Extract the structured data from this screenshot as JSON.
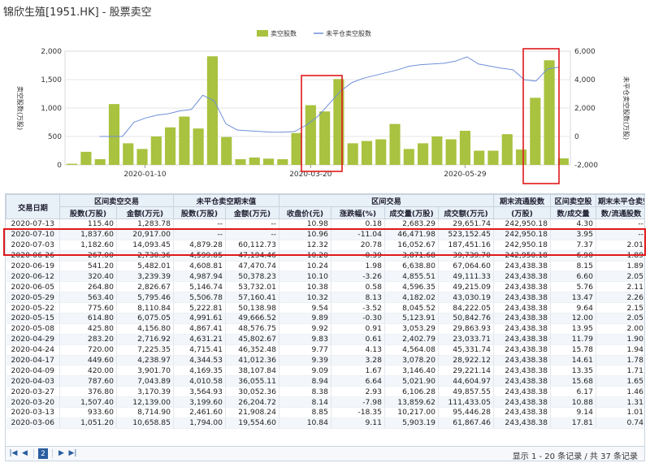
{
  "page": {
    "title": "锦欣生殖[1951.HK] - 股票卖空"
  },
  "colors": {
    "bar": "#a9c23f",
    "line": "#6f8fd8",
    "highlight": "#e0181b",
    "header_bg": "#e8f0f8"
  },
  "chart_data": {
    "type": "bar",
    "title": "",
    "y_left": {
      "ylim": [
        0,
        2000
      ],
      "ticks": [
        "0",
        "500",
        "1,000",
        "1,500",
        "2,000"
      ],
      "label": "卖空股数(万股)"
    },
    "y_right": {
      "ylim": [
        -2000,
        6000
      ],
      "ticks": [
        "-2,000",
        "0",
        "2,000",
        "4,000",
        "6,000"
      ],
      "label": "未平仓卖空股数(万股)"
    },
    "x_ticks": [
      "2020-01-10",
      "2020-03-20",
      "2020-05-29"
    ],
    "legend_position": "top-center",
    "grid": true,
    "series": [
      {
        "name": "卖空股数",
        "kind": "bar",
        "values": [
          20,
          230,
          100,
          1070,
          380,
          280,
          500,
          660,
          850,
          640,
          1910,
          490,
          100,
          130,
          110,
          100,
          560,
          1050,
          940,
          1510,
          380,
          420,
          450,
          720,
          280,
          380,
          500,
          450,
          600,
          250,
          250,
          540,
          270,
          1180,
          1840,
          115
        ]
      },
      {
        "name": "未平仓卖空股数",
        "kind": "line",
        "values": [
          null,
          null,
          0,
          0,
          0,
          1000,
          1300,
          1500,
          1600,
          1800,
          1900,
          2900,
          2500,
          900,
          450,
          400,
          350,
          300,
          300,
          350,
          800,
          1400,
          2300,
          3200,
          3800,
          4100,
          4300,
          4500,
          4700,
          4950,
          5050,
          5100,
          5150,
          5300,
          5600,
          5100,
          4950,
          4800,
          4700,
          3980,
          3900,
          4750,
          4880
        ]
      }
    ]
  },
  "table": {
    "group_headers": [
      "交易日期",
      "区间卖空交易",
      "未平仓卖空期末值",
      "区间交易",
      "期末流通股数",
      "区间卖空股",
      "期末未平仓卖空股"
    ],
    "sub_headers": [
      "股数(万股)",
      "金额(万元)",
      "股数(万股)",
      "金额(万元)",
      "收盘价(元)",
      "涨跌幅(%)",
      "成交量(万股)",
      "成交额(万元)",
      "(万股)",
      "数/成交量",
      "数/流通股数"
    ],
    "rows": [
      [
        "2020-07-13",
        "115.40",
        "1,283.78",
        "--",
        "--",
        "10.98",
        "0.18",
        "2,683.29",
        "29,651.74",
        "242,950.18",
        "4.30",
        "--"
      ],
      [
        "2020-07-10",
        "1,837.60",
        "20,917.00",
        "--",
        "--",
        "10.96",
        "-11.04",
        "46,471.98",
        "523,152.45",
        "242,950.18",
        "3.95",
        "--"
      ],
      [
        "2020-07-03",
        "1,182.60",
        "14,093.45",
        "4,879.28",
        "60,112.73",
        "12.32",
        "20.78",
        "16,052.67",
        "187,451.16",
        "242,950.18",
        "7.37",
        "2.01"
      ],
      [
        "2020-06-26",
        "267.00",
        "2,730.36",
        "4,599.85",
        "47,194.46",
        "10.20",
        "-0.39",
        "3,871.68",
        "39,739.70",
        "242,950.18",
        "6.90",
        "1.89"
      ],
      [
        "2020-06-19",
        "541.20",
        "5,482.01",
        "4,608.81",
        "47,470.74",
        "10.24",
        "1.98",
        "6,638.80",
        "67,064.60",
        "243,438.38",
        "8.15",
        "1.89"
      ],
      [
        "2020-06-12",
        "320.40",
        "3,239.39",
        "4,987.94",
        "50,378.23",
        "10.10",
        "-3.26",
        "4,855.51",
        "49,111.33",
        "243,438.38",
        "6.60",
        "2.05"
      ],
      [
        "2020-06-05",
        "264.80",
        "2,826.67",
        "5,146.74",
        "53,732.01",
        "10.38",
        "0.58",
        "4,596.35",
        "49,215.09",
        "243,438.38",
        "5.76",
        "2.11"
      ],
      [
        "2020-05-29",
        "563.40",
        "5,795.46",
        "5,506.78",
        "57,160.41",
        "10.32",
        "8.13",
        "4,182.02",
        "43,030.19",
        "243,438.38",
        "13.47",
        "2.26"
      ],
      [
        "2020-05-22",
        "775.60",
        "8,110.84",
        "5,222.81",
        "50,138.98",
        "9.54",
        "-3.52",
        "8,045.52",
        "84,222.05",
        "243,438.38",
        "9.64",
        "2.15"
      ],
      [
        "2020-05-15",
        "614.80",
        "6,075.05",
        "4,991.61",
        "49,666.52",
        "9.89",
        "-0.30",
        "5,123.91",
        "50,842.76",
        "243,438.38",
        "12.00",
        "2.05"
      ],
      [
        "2020-05-08",
        "425.80",
        "4,156.80",
        "4,867.41",
        "48,576.75",
        "9.92",
        "0.91",
        "3,053.29",
        "29,863.93",
        "243,438.38",
        "13.95",
        "2.00"
      ],
      [
        "2020-04-29",
        "283.20",
        "2,716.92",
        "4,631.21",
        "45,802.67",
        "9.83",
        "0.61",
        "2,402.79",
        "23,033.71",
        "243,438.38",
        "11.79",
        "1.90"
      ],
      [
        "2020-04-24",
        "720.00",
        "7,225.35",
        "4,715.41",
        "46,352.48",
        "9.77",
        "4.13",
        "4,564.08",
        "45,331.74",
        "243,438.38",
        "15.78",
        "1.94"
      ],
      [
        "2020-04-17",
        "449.60",
        "4,238.97",
        "4,344.53",
        "41,012.36",
        "9.39",
        "3.28",
        "3,078.20",
        "28,922.12",
        "243,438.38",
        "14.61",
        "1.78"
      ],
      [
        "2020-04-09",
        "420.00",
        "3,901.70",
        "4,169.35",
        "38,107.84",
        "9.09",
        "1.67",
        "3,146.40",
        "29,221.14",
        "243,438.38",
        "13.35",
        "1.71"
      ],
      [
        "2020-04-03",
        "787.60",
        "7,043.89",
        "4,010.58",
        "36,055.11",
        "8.94",
        "6.64",
        "5,021.90",
        "44,604.97",
        "243,438.38",
        "15.68",
        "1.65"
      ],
      [
        "2020-03-27",
        "376.80",
        "3,170.39",
        "3,564.93",
        "30,052.36",
        "8.38",
        "2.93",
        "6,106.28",
        "49,857.55",
        "243,438.38",
        "6.17",
        "1.46"
      ],
      [
        "2020-03-20",
        "1,507.40",
        "12,139.00",
        "3,199.60",
        "26,204.72",
        "8.14",
        "-7.98",
        "13,859.62",
        "111,433.05",
        "243,438.38",
        "10.88",
        "1.31"
      ],
      [
        "2020-03-13",
        "933.60",
        "8,714.90",
        "2,461.60",
        "21,908.24",
        "8.85",
        "-18.35",
        "10,217.00",
        "95,446.28",
        "243,438.38",
        "9.14",
        "1.01"
      ],
      [
        "2020-03-06",
        "1,051.20",
        "10,658.85",
        "1,794.00",
        "19,554.60",
        "10.84",
        "9.11",
        "5,903.19",
        "61,867.46",
        "243,438.38",
        "17.81",
        "0.74"
      ]
    ]
  },
  "footer": {
    "current_page": "2",
    "record_info": "显示 1 - 20 条记录 / 共 37 条记录",
    "icons": {
      "first": "first-page-icon",
      "prev": "prev-page-icon",
      "next": "next-page-icon",
      "last": "last-page-icon"
    }
  }
}
